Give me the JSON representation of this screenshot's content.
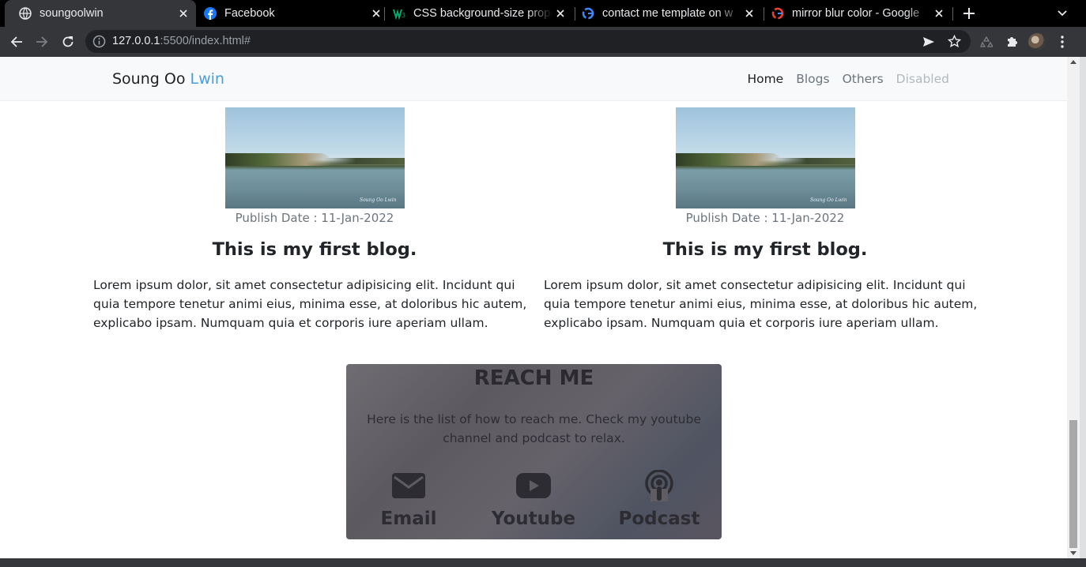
{
  "browser": {
    "tabs": [
      {
        "title": "soungoolwin",
        "favicon": "globe-icon",
        "active": true
      },
      {
        "title": "Facebook",
        "favicon": "facebook-icon",
        "active": false
      },
      {
        "title": "CSS background-size property",
        "favicon": "w3schools-icon",
        "active": false
      },
      {
        "title": "contact me template on w",
        "favicon": "google-icon",
        "active": false
      },
      {
        "title": "mirror blur color - Google",
        "favicon": "google-icon",
        "active": false
      }
    ],
    "url_host": "127.0.0.1",
    "url_rest": ":5500/index.html#"
  },
  "site": {
    "brand_first": "Soung Oo",
    "brand_highlight": "Lwin",
    "nav": [
      "Home",
      "Blogs",
      "Others",
      "Disabled"
    ]
  },
  "blogs": [
    {
      "date": "Publish Date : 11-Jan-2022",
      "title": "This is my first blog.",
      "body": "Lorem ipsum dolor, sit amet consectetur adipisicing elit. Incidunt qui quia tempore tenetur animi eius, minima esse, at doloribus hic autem, explicabo ipsam. Numquam quia et corporis iure aperiam ullam.",
      "image_caption": "Soung Oo Lwin"
    },
    {
      "date": "Publish Date : 11-Jan-2022",
      "title": "This is my first blog.",
      "body": "Lorem ipsum dolor, sit amet consectetur adipisicing elit. Incidunt qui quia tempore tenetur animi eius, minima esse, at doloribus hic autem, explicabo ipsam. Numquam quia et corporis iure aperiam ullam.",
      "image_caption": "Soung Oo Lwin"
    }
  ],
  "reach": {
    "title": "REACH ME",
    "description": "Here is the list of how to reach me. Check my youtube channel and podcast to relax.",
    "items": [
      {
        "label": "Email",
        "icon": "envelope-icon"
      },
      {
        "label": "Youtube",
        "icon": "youtube-icon"
      },
      {
        "label": "Podcast",
        "icon": "podcast-icon"
      }
    ]
  }
}
